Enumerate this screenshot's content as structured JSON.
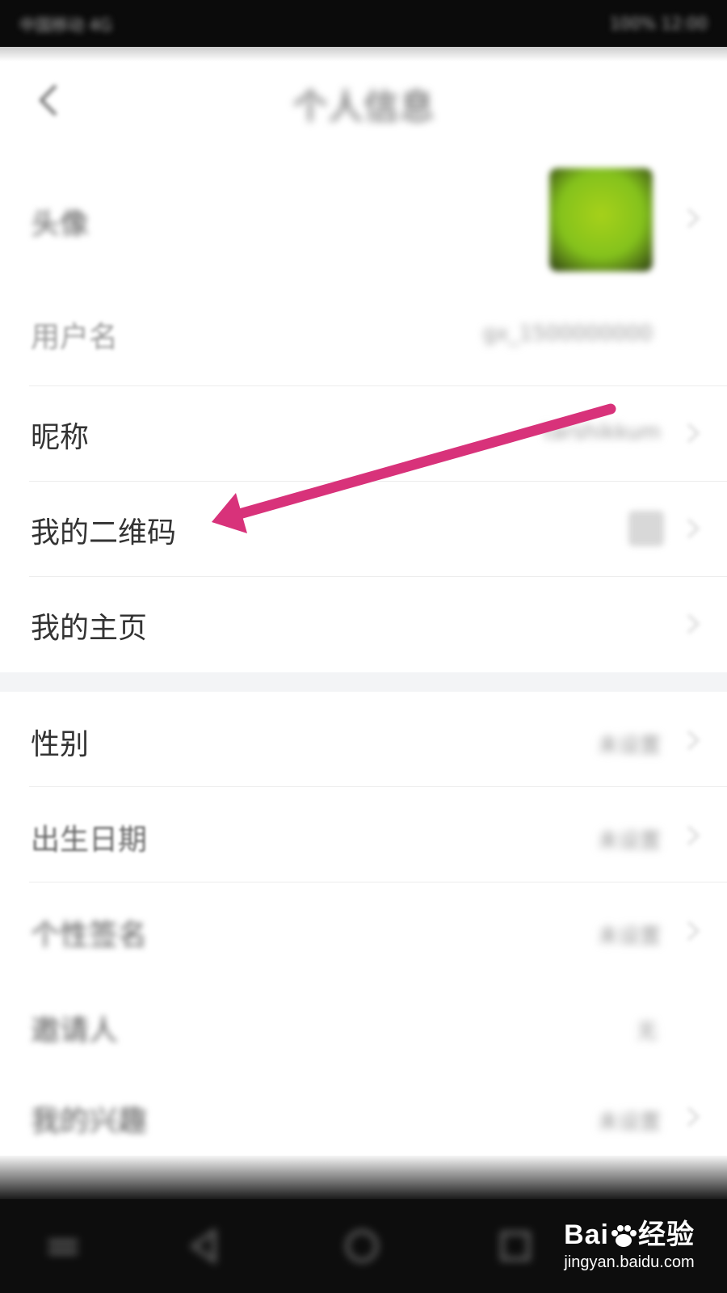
{
  "status_bar": {
    "left": "中国移动 4G",
    "right": "100% 12:00"
  },
  "header": {
    "title": "个人信息"
  },
  "rows": [
    {
      "label": "头像",
      "value": ""
    },
    {
      "label": "用户名",
      "value": "gx_1500000000"
    },
    {
      "label": "昵称",
      "value": "tarshikkum"
    },
    {
      "label": "我的二维码",
      "value": ""
    },
    {
      "label": "我的主页",
      "value": ""
    },
    {
      "label": "性别",
      "value": "未设置"
    },
    {
      "label": "出生日期",
      "value": "未设置"
    },
    {
      "label": "个性签名",
      "value": "未设置"
    },
    {
      "label": "邀请人",
      "value": "无"
    },
    {
      "label": "我的兴趣",
      "value": "未设置"
    }
  ],
  "watermark": {
    "brand_a": "Bai",
    "brand_b": "经验",
    "url": "jingyan.baidu.com"
  },
  "colors": {
    "annotation_arrow": "#d8327a",
    "avatar": "#8cc31d"
  }
}
